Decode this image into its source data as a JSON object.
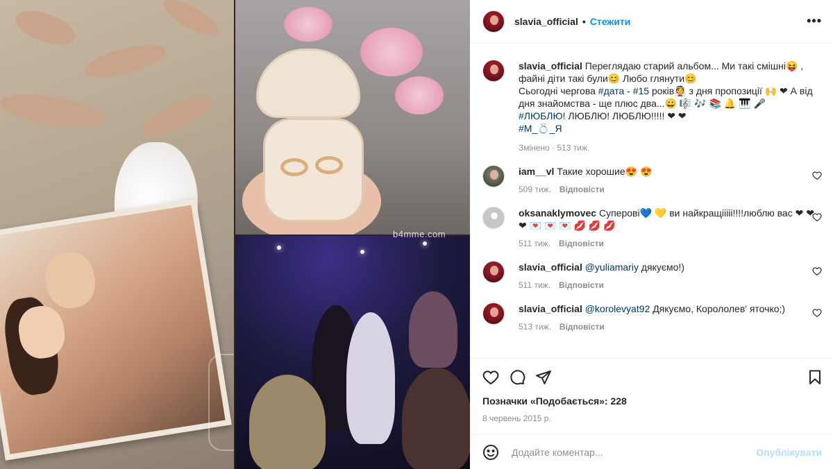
{
  "post": {
    "author": "slavia_official",
    "follow_label": "Стежити",
    "more_label": "•••",
    "watermark": "b4mme.com"
  },
  "caption": {
    "username": "slavia_official",
    "text_1": "Переглядаю старий альбом... Ми такі смішні😝 , файні діти такі були😊  Любо глянути😊",
    "text_2a": "Сьогодні чергова ",
    "hashtag_1": "#дата",
    "text_2b": " - ",
    "hashtag_2": "#15",
    "text_2c": " років👰 з дня пропозиції 🙌 ❤ А від дня знайомства - ще плюс два...😀 🎼 🎶 📚 🔔 🎹 🎤",
    "hashtag_3": "#ЛЮБЛЮ",
    "text_3": "! ЛЮБЛЮ! ЛЮБЛЮ!!!!! ❤ ❤",
    "hashtag_4": "#М_💍_Я",
    "edited": "Змінено",
    "edited_time": "513 тиж."
  },
  "comments": [
    {
      "username": "iam__vl",
      "text": "Такие хорошие😍 😍",
      "time": "509 тиж.",
      "reply": "Відповісти"
    },
    {
      "username": "oksanaklymovec",
      "text": "Суперові💙 💛 ви найкращііііі!!!!люблю вас ❤ ❤ ❤ 💌 💌 💌 💋 💋 💋",
      "time": "511 тиж.",
      "reply": "Відповісти"
    },
    {
      "username": "slavia_official",
      "mention": "@yuliamariy",
      "text": " дякуємо!)",
      "time": "511 тиж.",
      "reply": "Відповісти"
    },
    {
      "username": "slavia_official",
      "mention": "@korolevyat92",
      "text": " Дякуємо, Корололев' яточко;)",
      "time": "513 тиж.",
      "reply": "Відповісти"
    }
  ],
  "likes": {
    "label": "Позначки «Подобається»: 228"
  },
  "date": "8 червень 2015 р.",
  "composer": {
    "placeholder": "Додайте коментар...",
    "publish_label": "Опублікувати"
  },
  "icons": [
    "heart-icon",
    "comment-icon",
    "share-icon",
    "bookmark-icon",
    "smile-icon",
    "more-icon"
  ],
  "colors": {
    "accent": "#0095f6",
    "publish_disabled": "#b2dffc",
    "meta": "#8e8e8e"
  }
}
